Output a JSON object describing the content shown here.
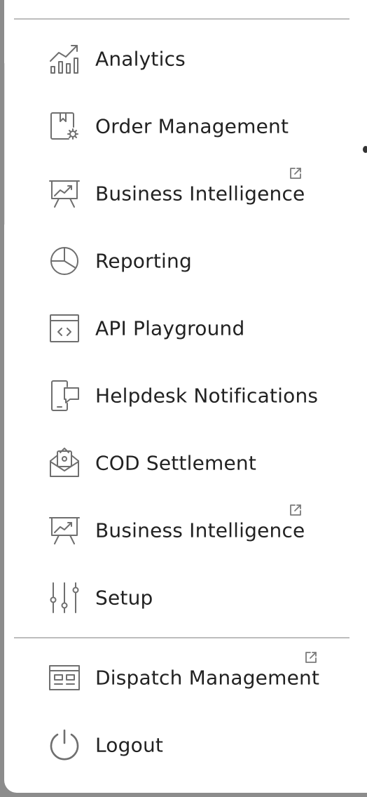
{
  "menu": {
    "items": [
      {
        "label": "Analytics",
        "icon": "analytics-chart-icon",
        "external": false
      },
      {
        "label": "Order Management",
        "icon": "order-management-icon",
        "external": false
      },
      {
        "label": "Business Intelligence",
        "icon": "presentation-board-icon",
        "external": true
      },
      {
        "label": "Reporting",
        "icon": "pie-chart-icon",
        "external": false
      },
      {
        "label": "API Playground",
        "icon": "code-window-icon",
        "external": false
      },
      {
        "label": "Helpdesk Notifications",
        "icon": "phone-chat-icon",
        "external": false
      },
      {
        "label": "COD Settlement",
        "icon": "envelope-money-icon",
        "external": false
      },
      {
        "label": "Business Intelligence",
        "icon": "presentation-board-icon",
        "external": true
      },
      {
        "label": "Setup",
        "icon": "sliders-icon",
        "external": false
      }
    ],
    "footer_items": [
      {
        "label": "Dispatch Management",
        "icon": "dispatch-board-icon",
        "external": true
      },
      {
        "label": "Logout",
        "icon": "power-icon",
        "external": false
      }
    ]
  },
  "colors": {
    "text": "#222222",
    "icon": "#6f6f6f",
    "divider": "#bdbdbd",
    "background": "#ffffff"
  }
}
